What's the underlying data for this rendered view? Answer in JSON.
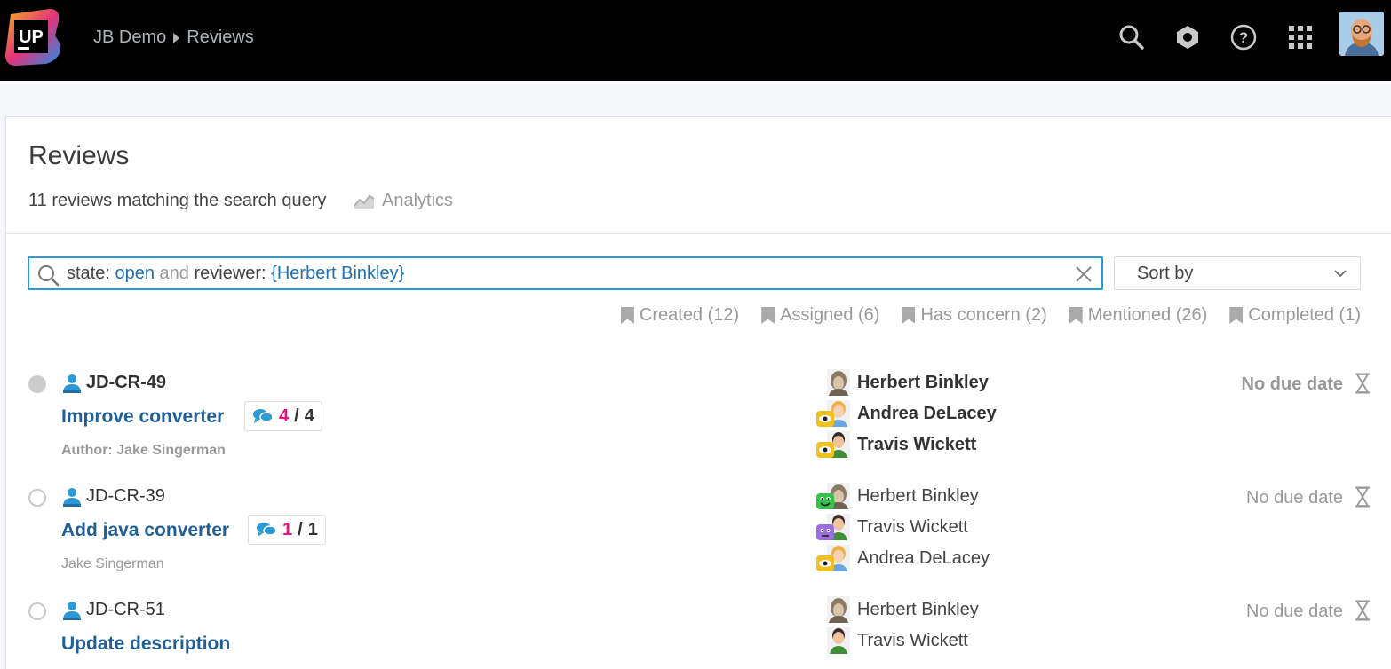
{
  "header": {
    "logo_text": "UP",
    "breadcrumb": [
      "JB Demo",
      "Reviews"
    ],
    "icons": [
      "search-icon",
      "hexagon-icon",
      "help-icon",
      "apps-grid-icon"
    ]
  },
  "page": {
    "title": "Reviews",
    "summary": "11 reviews matching the search query",
    "analytics_label": "Analytics"
  },
  "search": {
    "parts": [
      {
        "text": "state:",
        "kind": "kw"
      },
      {
        "text": " open",
        "kind": "val"
      },
      {
        "text": " and",
        "kind": "op"
      },
      {
        "text": " reviewer:",
        "kind": "kw"
      },
      {
        "text": " {Herbert Binkley}",
        "kind": "val"
      }
    ]
  },
  "sort": {
    "label": "Sort by"
  },
  "filters": [
    {
      "label": "Created (12)"
    },
    {
      "label": "Assigned (6)"
    },
    {
      "label": "Has concern (2)"
    },
    {
      "label": "Mentioned (26)"
    },
    {
      "label": "Completed (1)"
    }
  ],
  "reviews": [
    {
      "id": "JD-CR-49",
      "title": "Improve converter",
      "unread": "4",
      "total": "4",
      "author": "Author: Jake Singerman",
      "due": "No due date",
      "participants": [
        {
          "name": "Herbert Binkley",
          "badge": ""
        },
        {
          "name": "Andrea DeLacey",
          "badge": "eye"
        },
        {
          "name": "Travis Wickett",
          "badge": "eye"
        }
      ]
    },
    {
      "id": "JD-CR-39",
      "title": "Add java converter",
      "unread": "1",
      "total": "1",
      "author": "Jake Singerman",
      "due": "No due date",
      "participants": [
        {
          "name": "Herbert Binkley",
          "badge": "smile"
        },
        {
          "name": "Travis Wickett",
          "badge": "neutral"
        },
        {
          "name": "Andrea DeLacey",
          "badge": "eye"
        }
      ]
    },
    {
      "id": "JD-CR-51",
      "title": "Update description",
      "due": "No due date",
      "participants": [
        {
          "name": "Herbert Binkley",
          "badge": ""
        },
        {
          "name": "Travis Wickett",
          "badge": ""
        }
      ]
    }
  ]
}
